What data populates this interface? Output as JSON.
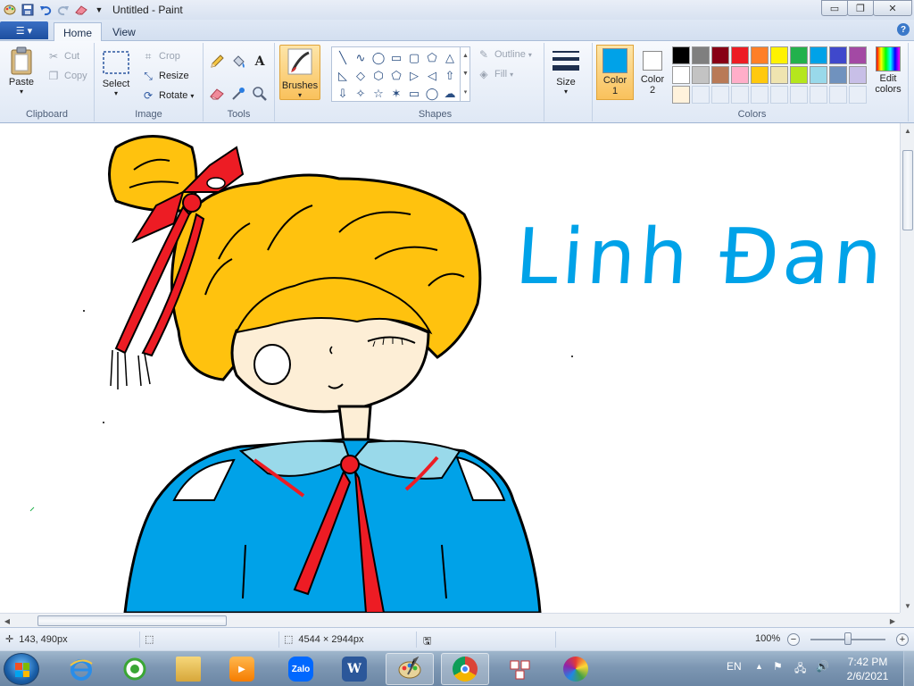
{
  "window": {
    "title": "Untitled - Paint",
    "minimize_glyph": "▭",
    "maximize_glyph": "❐",
    "close_glyph": "✕"
  },
  "tabs": [
    {
      "label": "Home",
      "active": true
    },
    {
      "label": "View",
      "active": false
    }
  ],
  "clipboard": {
    "group_label": "Clipboard",
    "paste": "Paste",
    "cut": "Cut",
    "copy": "Copy"
  },
  "image": {
    "group_label": "Image",
    "select": "Select",
    "crop": "Crop",
    "resize": "Resize",
    "rotate": "Rotate"
  },
  "tools": {
    "group_label": "Tools",
    "items": [
      "pencil-icon",
      "fill-icon",
      "text-icon",
      "eraser-icon",
      "color-picker-icon",
      "magnifier-icon"
    ]
  },
  "brushes": {
    "label": "Brushes"
  },
  "shapes": {
    "group_label": "Shapes",
    "outline": "Outline",
    "fill": "Fill",
    "glyphs": [
      "╲",
      "∿",
      "◯",
      "▭",
      "▢",
      "⬠",
      "△",
      "◺",
      "◇",
      "⬡",
      "⬠",
      "▷",
      "◁",
      "⇧",
      "⇩",
      "✧",
      "☆",
      "✶",
      "▭",
      "◯",
      "☁"
    ]
  },
  "size": {
    "label": "Size"
  },
  "colors": {
    "group_label": "Colors",
    "color1_label": "Color",
    "color1_num": "1",
    "color2_label": "Color",
    "color2_num": "2",
    "color1_value": "#00a2e8",
    "color2_value": "#ffffff",
    "edit_colors_line1": "Edit",
    "edit_colors_line2": "colors",
    "palette_row1": [
      "#000000",
      "#7f7f7f",
      "#880015",
      "#ed1c24",
      "#ff7f27",
      "#fff200",
      "#22b14c",
      "#00a2e8",
      "#3f48cc",
      "#a349a4"
    ],
    "palette_row2": [
      "#ffffff",
      "#c3c3c3",
      "#b97a57",
      "#ffaec9",
      "#ffc90e",
      "#efe4b0",
      "#b5e61d",
      "#99d9ea",
      "#7092be",
      "#c8bfe7"
    ],
    "palette_row3": [
      "#fff2dc",
      "",
      "",
      "",
      "",
      "",
      "",
      "",
      "",
      ""
    ]
  },
  "canvas": {
    "signature": "Linh Đan",
    "colors": {
      "hair": "#ffc20e",
      "skin": "#fdeed6",
      "ribbon": "#ed1c24",
      "shirt": "#00a2e8",
      "collar": "#99d9ea",
      "text": "#00a2e8"
    }
  },
  "status": {
    "cursor_pos": "143, 490px",
    "image_size": "4544 × 2944px",
    "zoom": "100%"
  },
  "taskbar": {
    "language": "EN",
    "time": "7:42 PM",
    "date": "2/6/2021",
    "apps": [
      "internet-explorer",
      "coccoc-browser",
      "file-explorer",
      "media-player",
      "zalo",
      "word",
      "paint",
      "chrome",
      "snipping-tool",
      "color-app"
    ],
    "zalo_label": "Zalo",
    "word_label": "W"
  }
}
